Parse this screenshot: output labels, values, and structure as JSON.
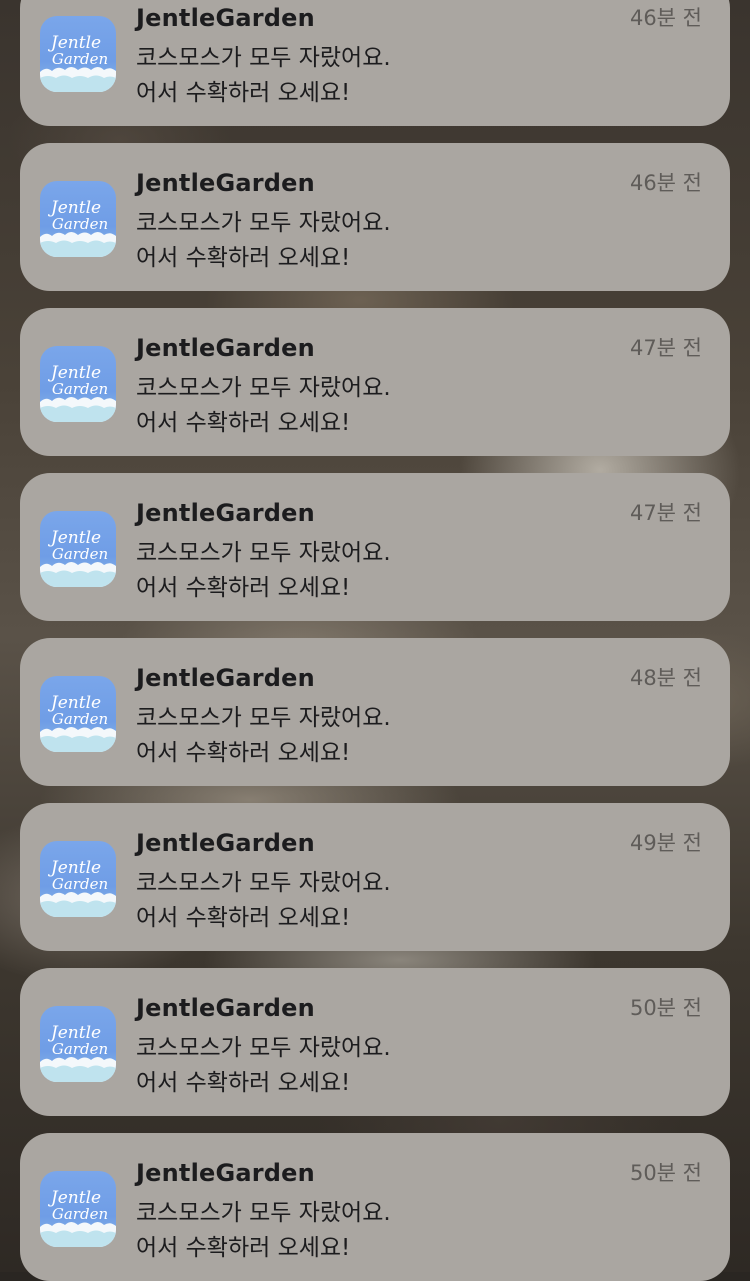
{
  "notifications": [
    {
      "app_name": "JentleGarden",
      "time": "46분 전",
      "line1": "코스모스가 모두 자랐어요.",
      "line2": "어서 수확하러 오세요!"
    },
    {
      "app_name": "JentleGarden",
      "time": "46분 전",
      "line1": "코스모스가 모두 자랐어요.",
      "line2": "어서 수확하러 오세요!"
    },
    {
      "app_name": "JentleGarden",
      "time": "47분 전",
      "line1": "코스모스가 모두 자랐어요.",
      "line2": "어서 수확하러 오세요!"
    },
    {
      "app_name": "JentleGarden",
      "time": "47분 전",
      "line1": "코스모스가 모두 자랐어요.",
      "line2": "어서 수확하러 오세요!"
    },
    {
      "app_name": "JentleGarden",
      "time": "48분 전",
      "line1": "코스모스가 모두 자랐어요.",
      "line2": "어서 수확하러 오세요!"
    },
    {
      "app_name": "JentleGarden",
      "time": "49분 전",
      "line1": "코스모스가 모두 자랐어요.",
      "line2": "어서 수확하러 오세요!"
    },
    {
      "app_name": "JentleGarden",
      "time": "50분 전",
      "line1": "코스모스가 모두 자랐어요.",
      "line2": "어서 수확하러 오세요!"
    },
    {
      "app_name": "JentleGarden",
      "time": "50분 전",
      "line1": "코스모스가 모두 자랐어요.",
      "line2": "어서 수확하러 오세요!"
    }
  ],
  "app_icon": {
    "icon": "jentlegarden-app-icon",
    "logo_line1": "Jentle",
    "logo_line2": "Garden",
    "background_color": "#7aa6ea"
  },
  "colors": {
    "card_background": "#aaa6a1",
    "title_text": "#1c1c1e",
    "time_text": "#5f5c59"
  }
}
